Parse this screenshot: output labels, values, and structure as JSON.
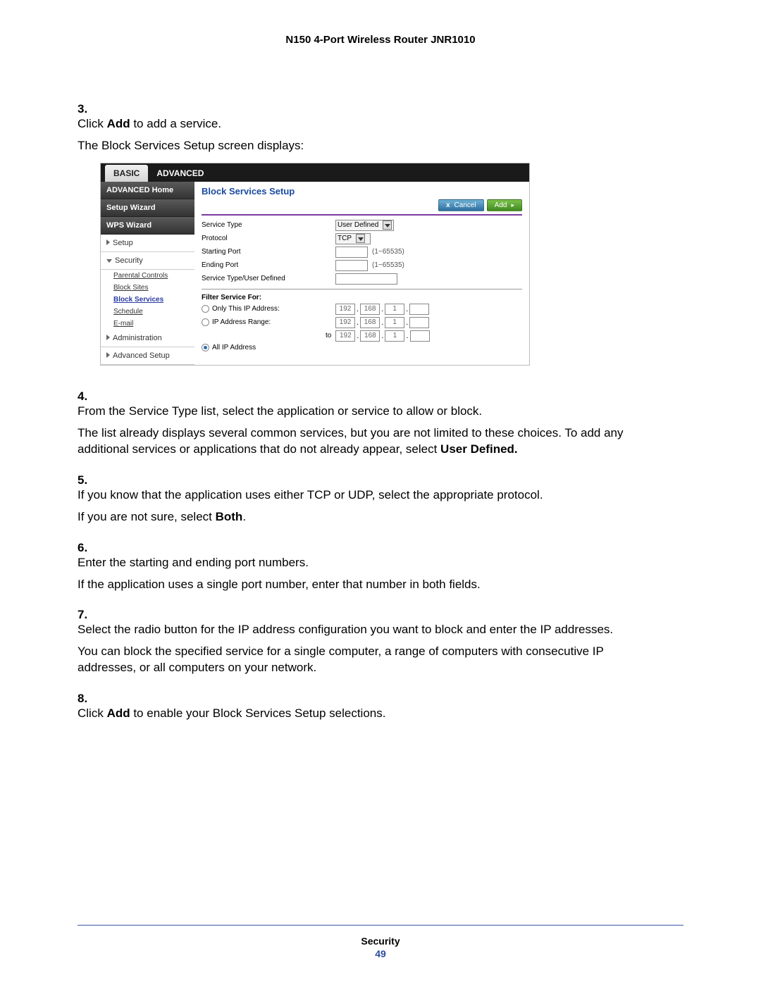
{
  "header": {
    "title": "N150 4-Port Wireless Router JNR1010"
  },
  "steps": {
    "s3": {
      "num": "3.",
      "a": "Click ",
      "b": "Add",
      "c": " to add a service.",
      "d": "The Block Services Setup screen displays:"
    },
    "s4": {
      "num": "4.",
      "a": "From the Service Type list, select the application or service to allow or block.",
      "b1": "The list already displays several common services, but you are not limited to these choices. To add any additional services or applications that do not already appear, select ",
      "b2": "User Defined."
    },
    "s5": {
      "num": "5.",
      "a": "If you know that the application uses either TCP or UDP, select the appropriate protocol.",
      "b1": "If you are not sure, select ",
      "b2": "Both",
      "b3": "."
    },
    "s6": {
      "num": "6.",
      "a": "Enter the starting and ending port numbers.",
      "b": "If the application uses a single port number, enter that number in both fields."
    },
    "s7": {
      "num": "7.",
      "a": "Select the radio button for the IP address configuration you want to block and enter the IP addresses.",
      "b": "You can block the specified service for a single computer, a range of computers with consecutive IP addresses, or all computers on your network."
    },
    "s8": {
      "num": "8.",
      "a": "Click ",
      "b": "Add",
      "c": " to enable your Block Services Setup selections."
    }
  },
  "screenshot": {
    "tabs": {
      "basic": "BASIC",
      "advanced": "ADVANCED"
    },
    "sidebar": {
      "items": [
        "ADVANCED Home",
        "Setup Wizard",
        "WPS Wizard",
        "Setup",
        "Security",
        "Administration",
        "Advanced Setup"
      ],
      "security_sub": [
        "Parental Controls",
        "Block Sites",
        "Block Services",
        "Schedule",
        "E-mail"
      ]
    },
    "panel": {
      "title": "Block Services Setup",
      "buttons": {
        "cancel": "Cancel",
        "add": "Add",
        "x": "x",
        "arrow": "▸"
      },
      "rows": {
        "service_type": {
          "label": "Service Type",
          "value": "User Defined"
        },
        "protocol": {
          "label": "Protocol",
          "value": "TCP"
        },
        "starting_port": {
          "label": "Starting Port",
          "hint": "(1~65535)"
        },
        "ending_port": {
          "label": "Ending Port",
          "hint": "(1~65535)"
        },
        "user_defined": {
          "label": "Service Type/User Defined"
        }
      },
      "filter": {
        "heading": "Filter Service For:",
        "only_this": "Only This IP Address:",
        "range": "IP Address Range:",
        "to": "to",
        "all": "All IP Address",
        "ip": [
          "192",
          "168",
          "1",
          ""
        ]
      }
    }
  },
  "footer": {
    "section": "Security",
    "page": "49"
  }
}
